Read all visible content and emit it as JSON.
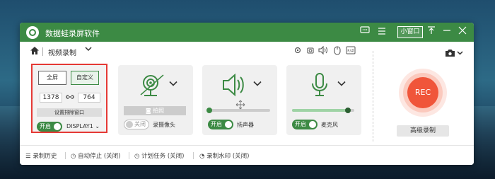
{
  "window": {
    "title": "数据蛙录屏软件",
    "mini_window": "小窗口"
  },
  "nav": {
    "title": "视频录制"
  },
  "record_area": {
    "full_label": "全屏",
    "custom_label": "自定义",
    "width": "1378",
    "height": "764",
    "exclude_label": "设置排除窗口",
    "toggle_label": "开启",
    "display_label": "DISPLAY1"
  },
  "webcam": {
    "snapshot_label": "拍照",
    "toggle_label": "关闭",
    "name": "录摄像头"
  },
  "speaker": {
    "toggle_label": "开启",
    "name": "扬声器",
    "volume": 0.55
  },
  "microphone": {
    "toggle_label": "开启",
    "name": "麦克风",
    "volume": 0.9
  },
  "rec": {
    "label": "REC",
    "advanced": "高级录制"
  },
  "footer": {
    "history": "录制历史",
    "auto_stop": "自动停止 (关闭)",
    "schedule": "计划任务 (关闭)",
    "watermark": "录制水印 (关闭)"
  },
  "colors": {
    "accent": "#3c8a44",
    "rec": "#f0553a",
    "highlight_border": "#e53935"
  }
}
